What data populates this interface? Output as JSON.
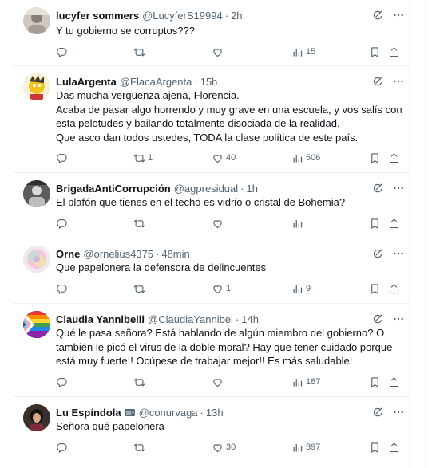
{
  "replies": [
    {
      "name": "lucyfer sommers",
      "handle": "@LucyferS19994",
      "time": "2h",
      "lines": [
        "Y tu gobierno se corruptos???"
      ],
      "counts": {
        "replies": "",
        "reposts": "",
        "likes": "",
        "views": "15"
      }
    },
    {
      "name": "LulaArgenta",
      "handle": "@FlacaArgenta",
      "time": "15h",
      "lines": [
        "Das mucha vergüenza ajena, Florencia.",
        "Acaba de pasar algo horrendo y muy grave en una escuela, y vos salís con",
        "esta pelotudes y bailando totalmente disociada de la realidad.",
        "Que asco dan todos ustedes, TODA la clase política de este país."
      ],
      "counts": {
        "replies": "",
        "reposts": "1",
        "likes": "40",
        "views": "506"
      }
    },
    {
      "name": "BrigadaAntiCorrupción",
      "handle": "@agpresidual",
      "time": "1h",
      "lines": [
        "El plafón que tienes en el techo es vidrio o cristal de Bohemia?"
      ],
      "counts": {
        "replies": "",
        "reposts": "",
        "likes": "",
        "views": ""
      }
    },
    {
      "name": "Orne",
      "handle": "@ornelius4375",
      "time": "48min",
      "lines": [
        "Que papelonera la defensora de delincuentes"
      ],
      "counts": {
        "replies": "",
        "reposts": "",
        "likes": "1",
        "views": "9"
      }
    },
    {
      "name": "Claudia Yannibelli",
      "handle": "@ClaudiaYannibel",
      "time": "14h",
      "lines": [
        "Qué le pasa señora? Está hablando de algún miembro del gobierno? O",
        "también le picó el virus de la doble moral? Hay que tener cuidado porque",
        "está muy fuerte!! Ocúpese de trabajar mejor!! Es más saludable!"
      ],
      "counts": {
        "replies": "",
        "reposts": "",
        "likes": "",
        "views": "187"
      }
    },
    {
      "name": "Lu Espíndola",
      "handle": "@conurvaga",
      "time": "13h",
      "lines": [
        "Señora qué papelonera"
      ],
      "counts": {
        "replies": "",
        "reposts": "",
        "likes": "30",
        "views": "397"
      }
    }
  ],
  "icons": {
    "reply": "reply-icon",
    "repost": "repost-icon",
    "like": "like-icon",
    "views": "views-icon",
    "bookmark": "bookmark-icon",
    "share": "share-icon",
    "grok": "grok-icon",
    "more": "more-icon"
  },
  "colors": {
    "text": "#0f1419",
    "secondary": "#536471",
    "divider": "#eff3f4"
  }
}
